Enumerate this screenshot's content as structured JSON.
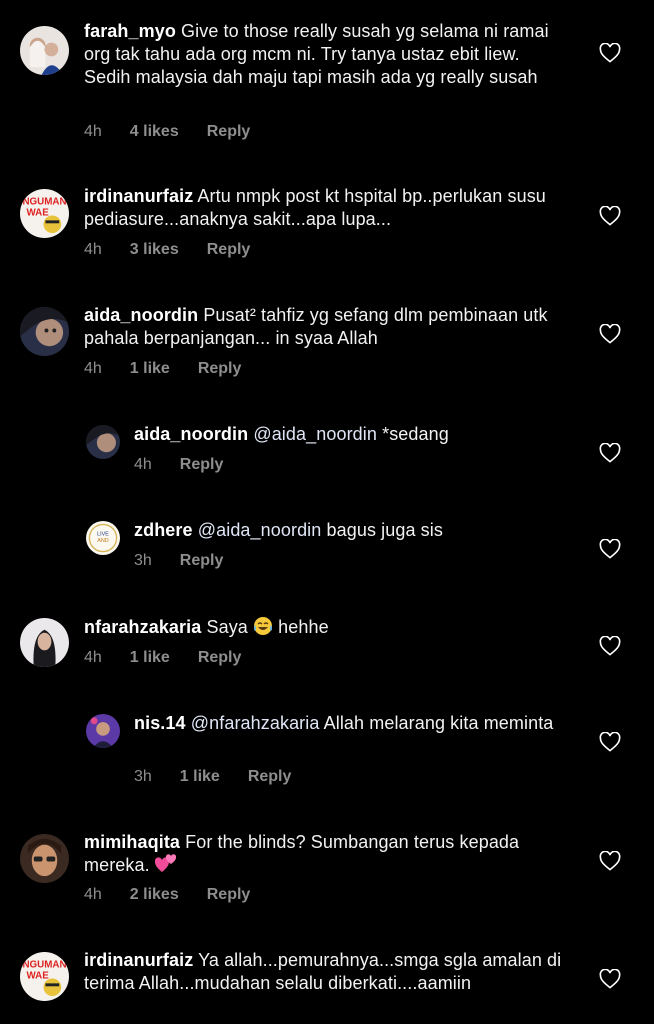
{
  "comments": [
    {
      "user": "farah_myo",
      "text": "Give to those really susah yg selama ni ramai org tak tahu ada org mcm ni. Try tanya ustaz ebit liew. Sedih malaysia dah maju tapi masih ada yg really susah",
      "time": "4h",
      "likes": "4 likes",
      "reply": "Reply"
    },
    {
      "user": "irdinanurfaiz",
      "text": "Artu nmpk post kt hspital bp..perlukan susu pediasure...anaknya sakit...apa lupa...",
      "time": "4h",
      "likes": "3 likes",
      "reply": "Reply"
    },
    {
      "user": "aida_noordin",
      "text": "Pusat² tahfiz yg sefang dlm pembinaan utk pahala berpanjangan... in syaa Allah",
      "time": "4h",
      "likes": "1 like",
      "reply": "Reply"
    },
    {
      "user": "aida_noordin",
      "mention": "@aida_noordin",
      "text": " *sedang",
      "time": "4h",
      "reply": "Reply"
    },
    {
      "user": "zdhere",
      "mention": "@aida_noordin",
      "text": " bagus juga sis",
      "time": "3h",
      "reply": "Reply"
    },
    {
      "user": "nfarahzakaria",
      "text": "Saya",
      "emoji": "tears-of-joy",
      "text2": "hehhe",
      "time": "4h",
      "likes": "1 like",
      "reply": "Reply"
    },
    {
      "user": "nis.14",
      "mention": "@nfarahzakaria",
      "text": " Allah melarang kita meminta",
      "time": "3h",
      "likes": "1 like",
      "reply": "Reply"
    },
    {
      "user": "mimihaqita",
      "text": "For the blinds? Sumbangan terus kepada mereka.",
      "emoji": "two-hearts",
      "time": "4h",
      "likes": "2 likes",
      "reply": "Reply"
    },
    {
      "user": "irdinanurfaiz",
      "text": "Ya allah...pemurahnya...smga sgla amalan di terima Allah...mudahan selalu diberkati....aamiin"
    }
  ],
  "icons": {
    "like": "heart-outline-icon"
  },
  "colors": {
    "background": "#000000",
    "meta": "#8e8e8e",
    "text": "#f2f2f2"
  }
}
